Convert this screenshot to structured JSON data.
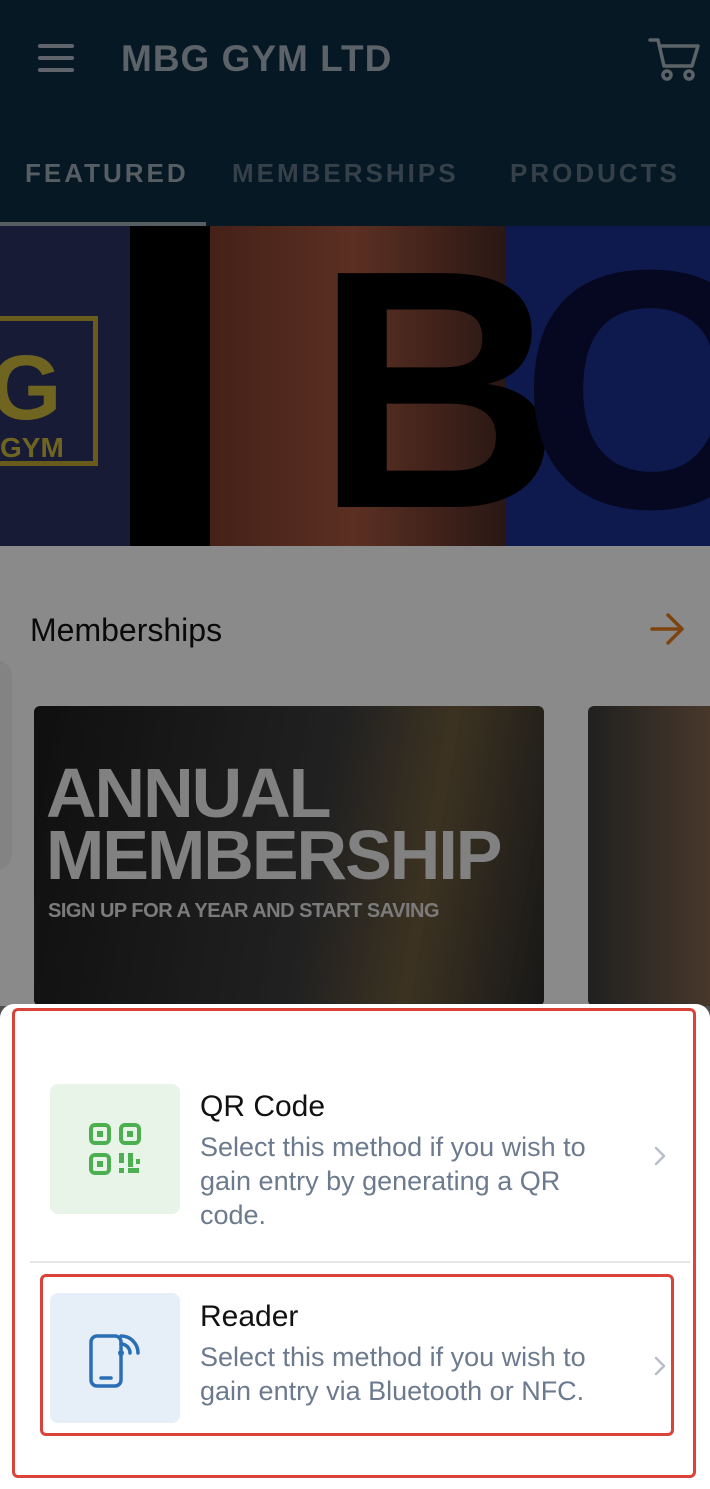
{
  "header": {
    "title": "MBG GYM LTD"
  },
  "tabs": [
    {
      "label": "FEATURED",
      "active": true
    },
    {
      "label": "MEMBERSHIPS",
      "active": false
    },
    {
      "label": "PRODUCTS",
      "active": false
    }
  ],
  "hero": {
    "logo_letter": "G",
    "logo_text": "GYM",
    "overlay_letter_1": "B",
    "overlay_letter_2": "C"
  },
  "memberships": {
    "section_title": "Memberships",
    "card": {
      "headline_line1": "ANNUAL",
      "headline_line2": "MEMBERSHIP",
      "subline": "SIGN UP FOR A YEAR AND START SAVING"
    }
  },
  "entry_sheet": {
    "options": [
      {
        "title": "QR Code",
        "description": "Select this method if you wish to gain entry by generating a QR code.",
        "icon": "qr-code-icon",
        "icon_color": "#4caf50"
      },
      {
        "title": "Reader",
        "description": "Select this method if you wish to gain entry via Bluetooth or NFC.",
        "icon": "phone-signal-icon",
        "icon_color": "#2a6fb5"
      }
    ]
  },
  "colors": {
    "header_bg": "#0b2b40",
    "accent_arrow": "#e07a1e",
    "highlight_outline": "#d9433a"
  }
}
